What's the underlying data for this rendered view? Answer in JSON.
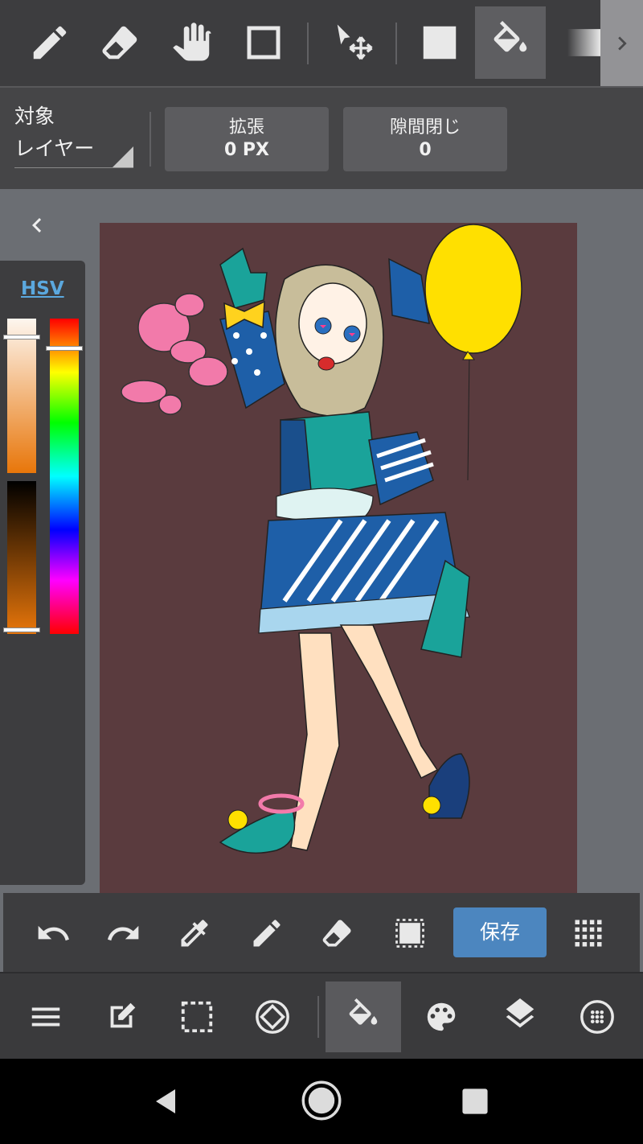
{
  "toolbar": {
    "tools": [
      {
        "name": "pen",
        "icon": "pencil-icon"
      },
      {
        "name": "eraser",
        "icon": "eraser-icon"
      },
      {
        "name": "hand",
        "icon": "hand-icon"
      },
      {
        "name": "shape",
        "icon": "square-outline-icon"
      },
      {
        "name": "move",
        "icon": "move-cursor-icon"
      },
      {
        "name": "fill-rect",
        "icon": "filled-square-icon"
      },
      {
        "name": "bucket",
        "icon": "paint-bucket-icon",
        "active": true
      },
      {
        "name": "gradient",
        "icon": "gradient-icon"
      }
    ],
    "scroll_icon": "chevron-right-icon"
  },
  "options": {
    "target_label": "対象",
    "target_value": "レイヤー",
    "expand_label": "拡張",
    "expand_value": "0 PX",
    "gap_label": "隙間閉じ",
    "gap_value": "0"
  },
  "color_panel": {
    "tab_label": "HSV",
    "current_color": "#e8760a"
  },
  "commands": {
    "save_label": "保存",
    "icons": [
      "undo-icon",
      "redo-icon",
      "eyedropper-icon",
      "pencil-icon",
      "eraser-icon",
      "selection-icon",
      "grid-icon"
    ]
  },
  "bottom_nav": {
    "icons": [
      "menu-icon",
      "edit-icon",
      "select-icon",
      "rotate-icon",
      "paint-bucket-icon",
      "palette-icon",
      "layers-icon",
      "brush-settings-icon"
    ],
    "active": "paint-bucket-icon"
  },
  "colors": {
    "canvas_bg": "#5a3b3e",
    "accent": "#4c86bf",
    "hsv_tab": "#5ba8de"
  }
}
